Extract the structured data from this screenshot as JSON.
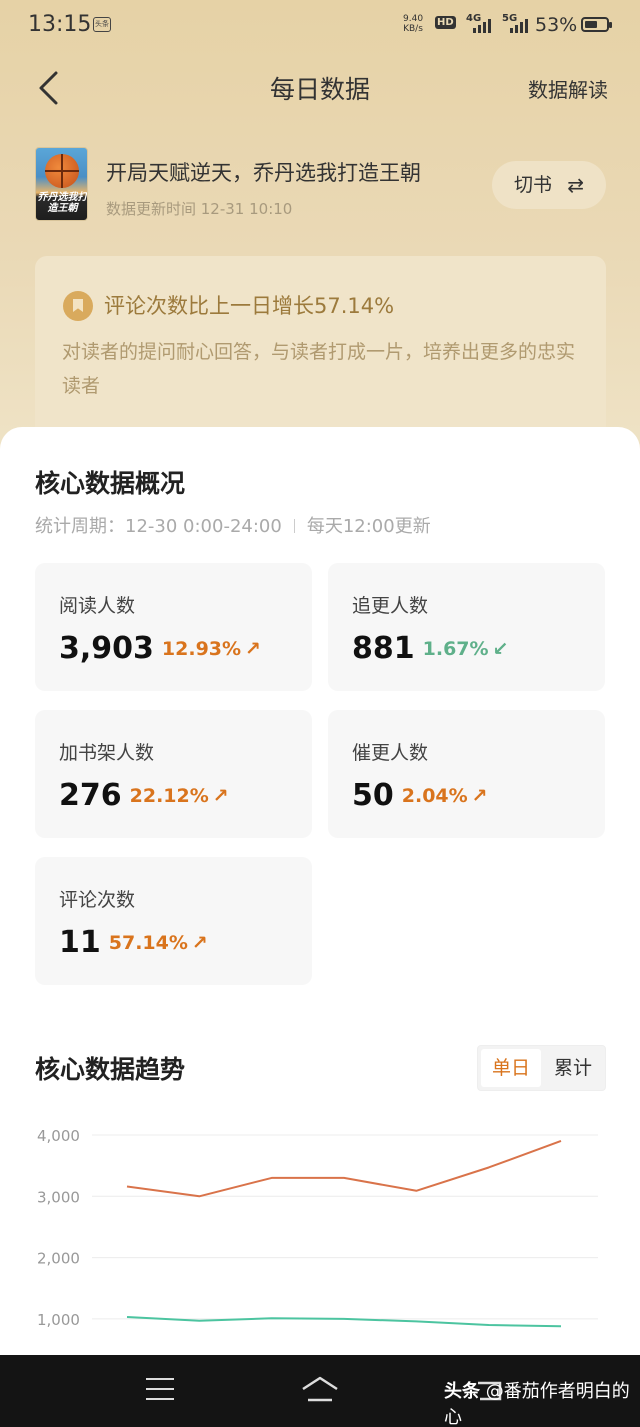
{
  "status_bar": {
    "time": "13:15",
    "app_badge": "头条",
    "speed_value": "9.40",
    "speed_unit": "KB/s",
    "hd": "HD",
    "net1": "4G",
    "net2": "5G",
    "battery": "53%"
  },
  "nav": {
    "title": "每日数据",
    "right_action": "数据解读"
  },
  "book": {
    "cover_text": "乔丹选我打造王朝",
    "title": "开局天赋逆天，乔丹选我打造王朝",
    "update_time": "数据更新时间 12-31 10:10",
    "switch_label": "切书",
    "switch_icon": "⇄"
  },
  "insight": {
    "icon": "bookmark-icon",
    "title": "评论次数比上一日增长57.14%",
    "desc": "对读者的提问耐心回答，与读者打成一片，培养出更多的忠实读者"
  },
  "overview": {
    "title": "核心数据概况",
    "period": "统计周期：12-30 0:00-24:00",
    "refresh": "每天12:00更新",
    "stats": [
      {
        "label": "阅读人数",
        "value": "3,903",
        "change": "12.93%",
        "arrow": "↗",
        "trend": "up"
      },
      {
        "label": "追更人数",
        "value": "881",
        "change": "1.67%",
        "arrow": "↙",
        "trend": "down"
      },
      {
        "label": "加书架人数",
        "value": "276",
        "change": "22.12%",
        "arrow": "↗",
        "trend": "up"
      },
      {
        "label": "催更人数",
        "value": "50",
        "change": "2.04%",
        "arrow": "↗",
        "trend": "up"
      },
      {
        "label": "评论次数",
        "value": "11",
        "change": "57.14%",
        "arrow": "↗",
        "trend": "up"
      }
    ]
  },
  "trend": {
    "title": "核心数据趋势",
    "toggle": {
      "single": "单日",
      "cumulative": "累计"
    }
  },
  "chart_data": {
    "type": "line",
    "ytick_labels": [
      "4,000",
      "3,000",
      "2,000",
      "1,000"
    ],
    "yticks": [
      4000,
      3000,
      2000,
      1000
    ],
    "ylim": [
      0,
      4000
    ],
    "x": [
      1,
      2,
      3,
      4,
      5,
      6,
      7
    ],
    "series": [
      {
        "values": [
          3160,
          3000,
          3300,
          3300,
          3090,
          3470,
          3903
        ],
        "color": "#d9734a"
      },
      {
        "values": [
          1030,
          970,
          1010,
          1000,
          960,
          900,
          881
        ],
        "color": "#4cc4a0"
      }
    ]
  },
  "bottom_bar": {
    "watermark_prefix": "头条",
    "watermark_text": "@番茄作者明白的心"
  },
  "colors": {
    "accent": "#d9741d",
    "down": "#5fb08a"
  }
}
